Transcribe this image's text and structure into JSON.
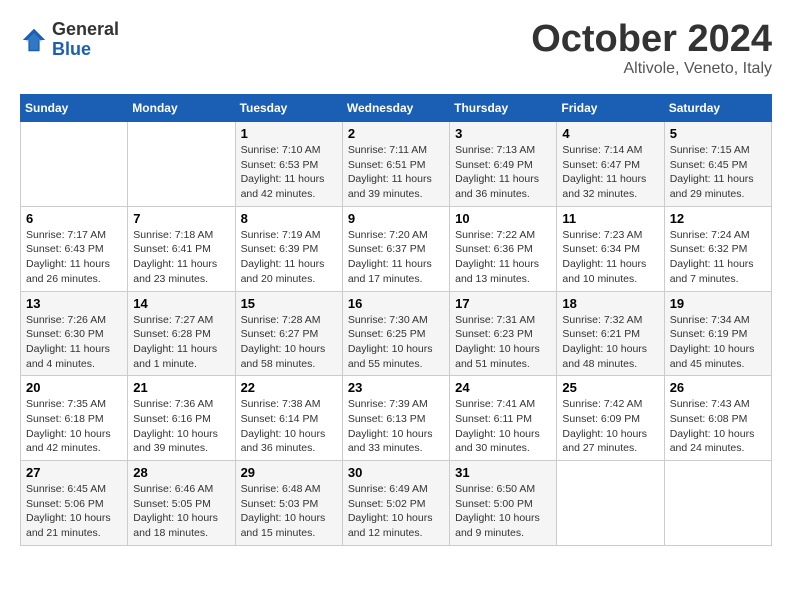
{
  "header": {
    "logo_general": "General",
    "logo_blue": "Blue",
    "title": "October 2024",
    "location": "Altivole, Veneto, Italy"
  },
  "days_of_week": [
    "Sunday",
    "Monday",
    "Tuesday",
    "Wednesday",
    "Thursday",
    "Friday",
    "Saturday"
  ],
  "weeks": [
    [
      {
        "day": "",
        "info": ""
      },
      {
        "day": "",
        "info": ""
      },
      {
        "day": "1",
        "info": "Sunrise: 7:10 AM\nSunset: 6:53 PM\nDaylight: 11 hours and 42 minutes."
      },
      {
        "day": "2",
        "info": "Sunrise: 7:11 AM\nSunset: 6:51 PM\nDaylight: 11 hours and 39 minutes."
      },
      {
        "day": "3",
        "info": "Sunrise: 7:13 AM\nSunset: 6:49 PM\nDaylight: 11 hours and 36 minutes."
      },
      {
        "day": "4",
        "info": "Sunrise: 7:14 AM\nSunset: 6:47 PM\nDaylight: 11 hours and 32 minutes."
      },
      {
        "day": "5",
        "info": "Sunrise: 7:15 AM\nSunset: 6:45 PM\nDaylight: 11 hours and 29 minutes."
      }
    ],
    [
      {
        "day": "6",
        "info": "Sunrise: 7:17 AM\nSunset: 6:43 PM\nDaylight: 11 hours and 26 minutes."
      },
      {
        "day": "7",
        "info": "Sunrise: 7:18 AM\nSunset: 6:41 PM\nDaylight: 11 hours and 23 minutes."
      },
      {
        "day": "8",
        "info": "Sunrise: 7:19 AM\nSunset: 6:39 PM\nDaylight: 11 hours and 20 minutes."
      },
      {
        "day": "9",
        "info": "Sunrise: 7:20 AM\nSunset: 6:37 PM\nDaylight: 11 hours and 17 minutes."
      },
      {
        "day": "10",
        "info": "Sunrise: 7:22 AM\nSunset: 6:36 PM\nDaylight: 11 hours and 13 minutes."
      },
      {
        "day": "11",
        "info": "Sunrise: 7:23 AM\nSunset: 6:34 PM\nDaylight: 11 hours and 10 minutes."
      },
      {
        "day": "12",
        "info": "Sunrise: 7:24 AM\nSunset: 6:32 PM\nDaylight: 11 hours and 7 minutes."
      }
    ],
    [
      {
        "day": "13",
        "info": "Sunrise: 7:26 AM\nSunset: 6:30 PM\nDaylight: 11 hours and 4 minutes."
      },
      {
        "day": "14",
        "info": "Sunrise: 7:27 AM\nSunset: 6:28 PM\nDaylight: 11 hours and 1 minute."
      },
      {
        "day": "15",
        "info": "Sunrise: 7:28 AM\nSunset: 6:27 PM\nDaylight: 10 hours and 58 minutes."
      },
      {
        "day": "16",
        "info": "Sunrise: 7:30 AM\nSunset: 6:25 PM\nDaylight: 10 hours and 55 minutes."
      },
      {
        "day": "17",
        "info": "Sunrise: 7:31 AM\nSunset: 6:23 PM\nDaylight: 10 hours and 51 minutes."
      },
      {
        "day": "18",
        "info": "Sunrise: 7:32 AM\nSunset: 6:21 PM\nDaylight: 10 hours and 48 minutes."
      },
      {
        "day": "19",
        "info": "Sunrise: 7:34 AM\nSunset: 6:19 PM\nDaylight: 10 hours and 45 minutes."
      }
    ],
    [
      {
        "day": "20",
        "info": "Sunrise: 7:35 AM\nSunset: 6:18 PM\nDaylight: 10 hours and 42 minutes."
      },
      {
        "day": "21",
        "info": "Sunrise: 7:36 AM\nSunset: 6:16 PM\nDaylight: 10 hours and 39 minutes."
      },
      {
        "day": "22",
        "info": "Sunrise: 7:38 AM\nSunset: 6:14 PM\nDaylight: 10 hours and 36 minutes."
      },
      {
        "day": "23",
        "info": "Sunrise: 7:39 AM\nSunset: 6:13 PM\nDaylight: 10 hours and 33 minutes."
      },
      {
        "day": "24",
        "info": "Sunrise: 7:41 AM\nSunset: 6:11 PM\nDaylight: 10 hours and 30 minutes."
      },
      {
        "day": "25",
        "info": "Sunrise: 7:42 AM\nSunset: 6:09 PM\nDaylight: 10 hours and 27 minutes."
      },
      {
        "day": "26",
        "info": "Sunrise: 7:43 AM\nSunset: 6:08 PM\nDaylight: 10 hours and 24 minutes."
      }
    ],
    [
      {
        "day": "27",
        "info": "Sunrise: 6:45 AM\nSunset: 5:06 PM\nDaylight: 10 hours and 21 minutes."
      },
      {
        "day": "28",
        "info": "Sunrise: 6:46 AM\nSunset: 5:05 PM\nDaylight: 10 hours and 18 minutes."
      },
      {
        "day": "29",
        "info": "Sunrise: 6:48 AM\nSunset: 5:03 PM\nDaylight: 10 hours and 15 minutes."
      },
      {
        "day": "30",
        "info": "Sunrise: 6:49 AM\nSunset: 5:02 PM\nDaylight: 10 hours and 12 minutes."
      },
      {
        "day": "31",
        "info": "Sunrise: 6:50 AM\nSunset: 5:00 PM\nDaylight: 10 hours and 9 minutes."
      },
      {
        "day": "",
        "info": ""
      },
      {
        "day": "",
        "info": ""
      }
    ]
  ]
}
